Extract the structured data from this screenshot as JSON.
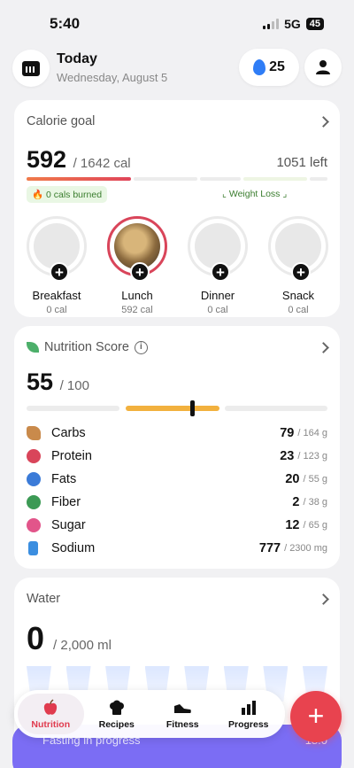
{
  "status_bar": {
    "time": "5:40",
    "network": "5G",
    "battery": "45"
  },
  "header": {
    "title": "Today",
    "date": "Wednesday, August 5",
    "streak": "25"
  },
  "calorie_goal": {
    "title": "Calorie goal",
    "consumed": "592",
    "goal_text": "/ 1642 cal",
    "left_text": "1051 left",
    "burned_text": "0 cals burned",
    "plan_text": "Weight Loss",
    "meals": [
      {
        "name": "Breakfast",
        "cal": "0 cal"
      },
      {
        "name": "Lunch",
        "cal": "592 cal"
      },
      {
        "name": "Dinner",
        "cal": "0 cal"
      },
      {
        "name": "Snack",
        "cal": "0 cal"
      }
    ]
  },
  "nutrition": {
    "title": "Nutrition Score",
    "score": "55",
    "score_max": "/ 100",
    "score_fraction": 0.55,
    "rows": [
      {
        "label": "Carbs",
        "value": "79",
        "max": "/ 164 g",
        "color": "#c98a4b"
      },
      {
        "label": "Protein",
        "value": "23",
        "max": "/ 123 g",
        "color": "#d9455a"
      },
      {
        "label": "Fats",
        "value": "20",
        "max": "/ 55 g",
        "color": "#3b7bd8"
      },
      {
        "label": "Fiber",
        "value": "2",
        "max": "/ 38 g",
        "color": "#3c9a55"
      },
      {
        "label": "Sugar",
        "value": "12",
        "max": "/ 65 g",
        "color": "#e2558a"
      },
      {
        "label": "Sodium",
        "value": "777",
        "max": "/ 2300 mg",
        "color": "#3b8ee0"
      }
    ]
  },
  "water": {
    "title": "Water",
    "amount": "0",
    "goal": "/ 2,000 ml"
  },
  "fasting": {
    "label": "Fasting in progress",
    "time": "18:0"
  },
  "tabs": [
    {
      "label": "Nutrition"
    },
    {
      "label": "Recipes"
    },
    {
      "label": "Fitness"
    },
    {
      "label": "Progress"
    }
  ],
  "fab": {
    "label": "+"
  }
}
